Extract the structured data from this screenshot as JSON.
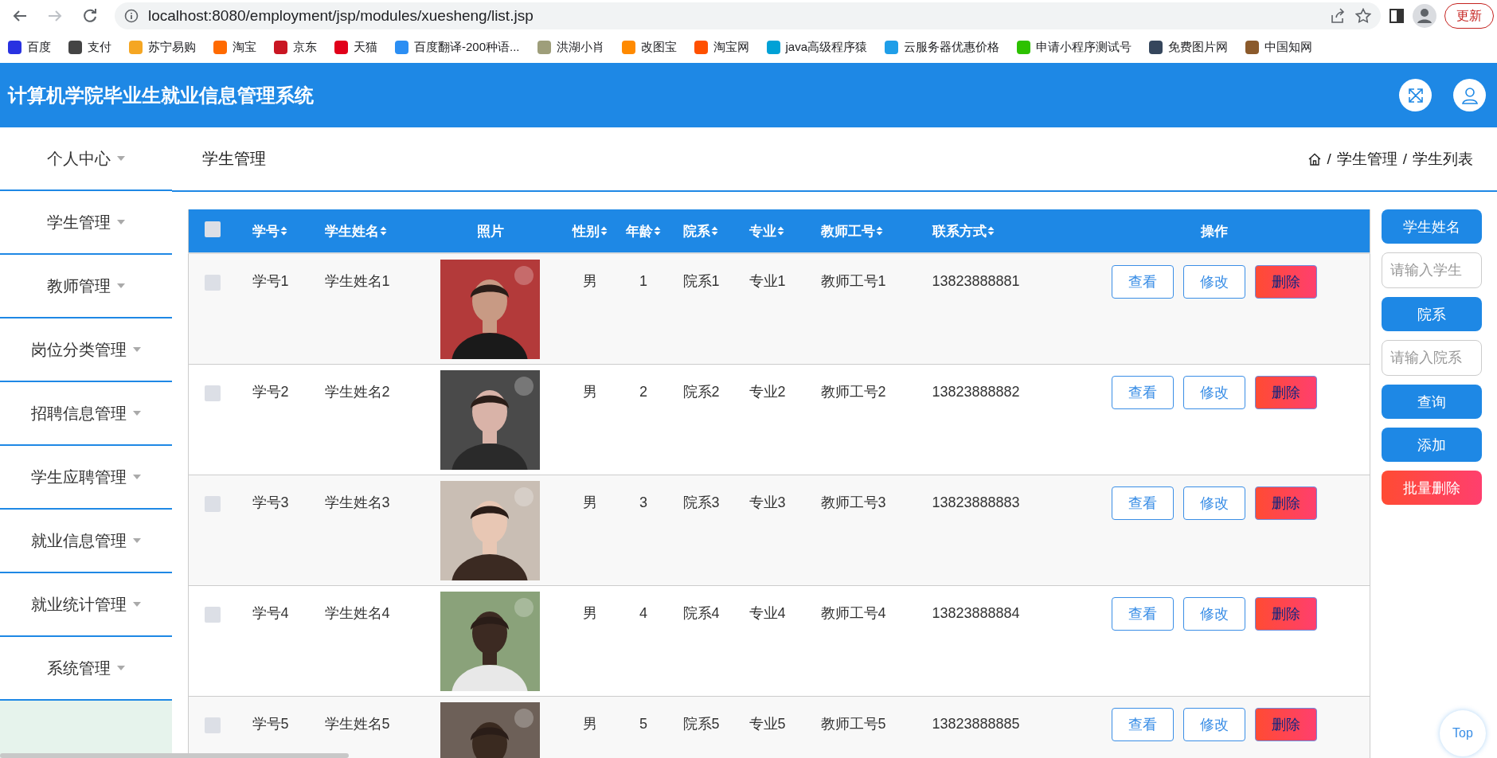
{
  "browser": {
    "url": "localhost:8080/employment/jsp/modules/xuesheng/list.jsp",
    "update_button": "更新",
    "bookmarks": [
      {
        "label": "百度",
        "color": "#2932e1"
      },
      {
        "label": "支付",
        "color": "#444444"
      },
      {
        "label": "苏宁易购",
        "color": "#f5a623"
      },
      {
        "label": "淘宝",
        "color": "#ff6a00"
      },
      {
        "label": "京东",
        "color": "#c91623"
      },
      {
        "label": "天猫",
        "color": "#e1001a"
      },
      {
        "label": "百度翻译-200种语...",
        "color": "#2b8ef3"
      },
      {
        "label": "洪湖小肖",
        "color": "#9e9e7a"
      },
      {
        "label": "改图宝",
        "color": "#ff8a00"
      },
      {
        "label": "淘宝网",
        "color": "#ff5000"
      },
      {
        "label": "java高级程序猿",
        "color": "#00a1d6"
      },
      {
        "label": "云服务器优惠价格",
        "color": "#1f9ee8"
      },
      {
        "label": "申请小程序测试号",
        "color": "#2dc100"
      },
      {
        "label": "免费图片网",
        "color": "#35465c"
      },
      {
        "label": "中国知网",
        "color": "#8b5a2b"
      }
    ]
  },
  "header": {
    "title": "计算机学院毕业生就业信息管理系统"
  },
  "sidebar": {
    "items": [
      {
        "label": "个人中心"
      },
      {
        "label": "学生管理"
      },
      {
        "label": "教师管理"
      },
      {
        "label": "岗位分类管理"
      },
      {
        "label": "招聘信息管理"
      },
      {
        "label": "学生应聘管理"
      },
      {
        "label": "就业信息管理"
      },
      {
        "label": "就业统计管理"
      },
      {
        "label": "系统管理"
      }
    ]
  },
  "page_title": "学生管理",
  "breadcrumb": [
    {
      "separator": "/",
      "label": "学生管理"
    },
    {
      "separator": "/",
      "label": "学生列表"
    }
  ],
  "table": {
    "select_all_checked": false,
    "columns": [
      {
        "label": "学号",
        "sortable": true
      },
      {
        "label": "学生姓名",
        "sortable": true
      },
      {
        "label": "照片",
        "sortable": false
      },
      {
        "label": "性别",
        "sortable": true
      },
      {
        "label": "年龄",
        "sortable": true
      },
      {
        "label": "院系",
        "sortable": true
      },
      {
        "label": "专业",
        "sortable": true
      },
      {
        "label": "教师工号",
        "sortable": true
      },
      {
        "label": "联系方式",
        "sortable": true
      },
      {
        "label": "操作",
        "sortable": false
      }
    ],
    "rows": [
      {
        "checked": false,
        "cells": [
          "学号1",
          "学生姓名1",
          {
            "kind": "picture"
          },
          "男",
          "1",
          "院系1",
          "专业1",
          "教师工号1",
          "13823888881"
        ],
        "actions": [
          {
            "label": "查看",
            "kind": "view"
          },
          {
            "label": "修改",
            "kind": "edit"
          },
          {
            "label": "删除",
            "kind": "delete"
          }
        ]
      },
      {
        "checked": false,
        "cells": [
          "学号2",
          "学生姓名2",
          {
            "kind": "picture"
          },
          "男",
          "2",
          "院系2",
          "专业2",
          "教师工号2",
          "13823888882"
        ],
        "actions": [
          {
            "label": "查看",
            "kind": "view"
          },
          {
            "label": "修改",
            "kind": "edit"
          },
          {
            "label": "删除",
            "kind": "delete"
          }
        ]
      },
      {
        "checked": false,
        "cells": [
          "学号3",
          "学生姓名3",
          {
            "kind": "picture"
          },
          "男",
          "3",
          "院系3",
          "专业3",
          "教师工号3",
          "13823888883"
        ],
        "actions": [
          {
            "label": "查看",
            "kind": "view"
          },
          {
            "label": "修改",
            "kind": "edit"
          },
          {
            "label": "删除",
            "kind": "delete"
          }
        ]
      },
      {
        "checked": false,
        "cells": [
          "学号4",
          "学生姓名4",
          {
            "kind": "picture"
          },
          "男",
          "4",
          "院系4",
          "专业4",
          "教师工号4",
          "13823888884"
        ],
        "actions": [
          {
            "label": "查看",
            "kind": "view"
          },
          {
            "label": "修改",
            "kind": "edit"
          },
          {
            "label": "删除",
            "kind": "delete"
          }
        ]
      },
      {
        "checked": false,
        "cells": [
          "学号5",
          "学生姓名5",
          {
            "kind": "picture"
          },
          "男",
          "5",
          "院系5",
          "专业5",
          "教师工号5",
          "13823888885"
        ],
        "actions": [
          {
            "label": "查看",
            "kind": "view"
          },
          {
            "label": "修改",
            "kind": "edit"
          },
          {
            "label": "删除",
            "kind": "delete"
          }
        ]
      }
    ]
  },
  "search_panel": [
    {
      "kind": "label",
      "text": "学生姓名"
    },
    {
      "kind": "input",
      "placeholder": "请输入学生"
    },
    {
      "kind": "label",
      "text": "院系"
    },
    {
      "kind": "input",
      "placeholder": "请输入院系"
    },
    {
      "kind": "button",
      "text": "查询"
    },
    {
      "kind": "button",
      "text": "添加"
    },
    {
      "kind": "danger",
      "text": "批量删除"
    }
  ],
  "back_to_top": "Top"
}
